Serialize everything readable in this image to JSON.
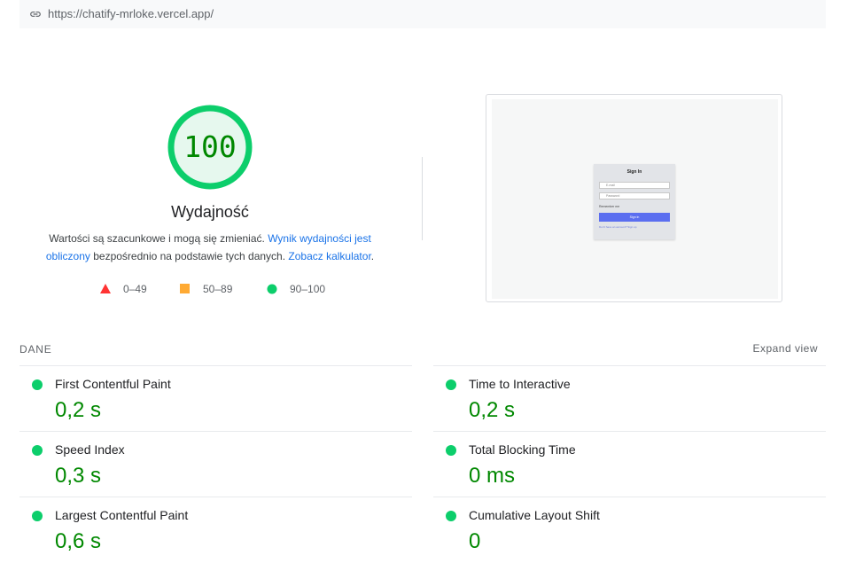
{
  "url_bar": {
    "url": "https://chatify-mrloke.vercel.app/",
    "icon": "link-icon"
  },
  "score": {
    "value": "100",
    "title": "Wydajność",
    "description_1": "Wartości są szacunkowe i mogą się zmieniać. ",
    "link_1": "Wynik wydajności jest obliczony",
    "description_2": " bezpośrednio na podstawie tych danych. ",
    "link_2": "Zobacz kalkulator",
    "description_3": ".",
    "color_good": "#0cce6b",
    "color_good_text": "#008800",
    "color_good_bg": "#e6f8ee"
  },
  "legend": [
    {
      "label": "0–49",
      "shape": "triangle",
      "color": "#ff3333"
    },
    {
      "label": "50–89",
      "shape": "square",
      "color": "#ffaa33"
    },
    {
      "label": "90–100",
      "shape": "circle",
      "color": "#0cce6b"
    }
  ],
  "screenshot_preview": {
    "title": "Sign In",
    "email_placeholder": "E-mail",
    "password_placeholder": "Password",
    "remember": "Remember me",
    "button": "Sign in",
    "signup_text": "Don't have an account? Sign up",
    "button_color": "#5b6ef0"
  },
  "metrics_section": {
    "label": "DANE",
    "expand": "Expand view",
    "items": [
      {
        "name": "First Contentful Paint",
        "value": "0,2 s"
      },
      {
        "name": "Time to Interactive",
        "value": "0,2 s"
      },
      {
        "name": "Speed Index",
        "value": "0,3 s"
      },
      {
        "name": "Total Blocking Time",
        "value": "0 ms"
      },
      {
        "name": "Largest Contentful Paint",
        "value": "0,6 s"
      },
      {
        "name": "Cumulative Layout Shift",
        "value": "0"
      }
    ]
  }
}
